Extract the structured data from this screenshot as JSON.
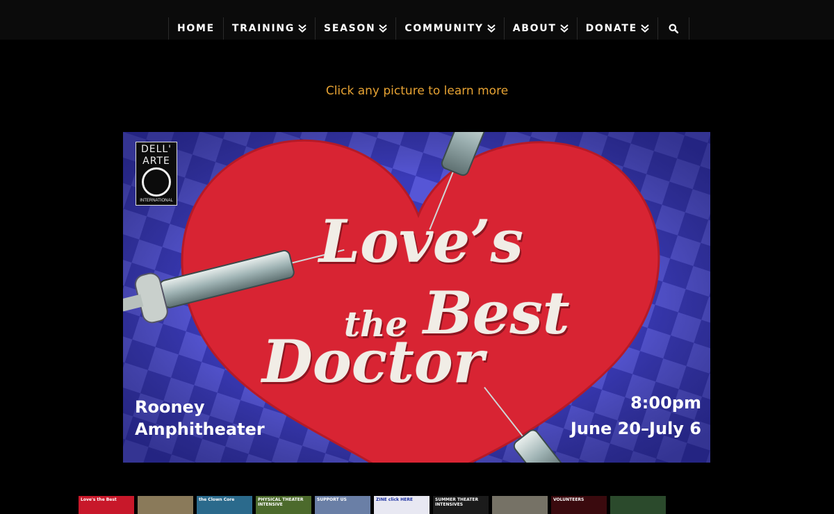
{
  "nav": {
    "items": [
      {
        "label": "HOME",
        "has_dropdown": false
      },
      {
        "label": "TRAINING",
        "has_dropdown": true
      },
      {
        "label": "SEASON",
        "has_dropdown": true
      },
      {
        "label": "COMMUNITY",
        "has_dropdown": true
      },
      {
        "label": "ABOUT",
        "has_dropdown": true
      },
      {
        "label": "DONATE",
        "has_dropdown": true
      }
    ],
    "search_icon": "search-icon"
  },
  "prompt": "Click any picture to learn more",
  "hero": {
    "logo": {
      "line1": "DELL'",
      "line2": "ARTE",
      "line3": "INTERNATIONAL"
    },
    "title": {
      "line1": "Love’s",
      "line2": "the",
      "line3": "Best",
      "line4": "Doctor"
    },
    "venue": {
      "line1": "Rooney",
      "line2": "Amphitheater"
    },
    "time": "8:00pm",
    "dates": "June 20–July 6"
  },
  "thumbnails": [
    {
      "label": "Love's the Best",
      "bg": "#c8182a"
    },
    {
      "label": "",
      "bg": "#8a7a5a"
    },
    {
      "label": "the Clown Core",
      "bg": "#2b6a8c"
    },
    {
      "label": "PHYSICAL THEATER INTENSIVE",
      "bg": "#4c6a2c"
    },
    {
      "label": "SUPPORT US",
      "bg": "#6a7fa6"
    },
    {
      "label": "ZINE click HERE",
      "bg": "#e8e8f2"
    },
    {
      "label": "SUMMER THEATER INTENSIVES",
      "bg": "#1b1b1b"
    },
    {
      "label": "",
      "bg": "#767266"
    },
    {
      "label": "VOLUNTEERS",
      "bg": "#3a0a0e"
    },
    {
      "label": "",
      "bg": "#2b4a2c"
    }
  ],
  "colors": {
    "accent": "#e6a233",
    "heart": "#d82433",
    "checker_a": "#3a3ab8",
    "checker_b": "#5656d6"
  }
}
